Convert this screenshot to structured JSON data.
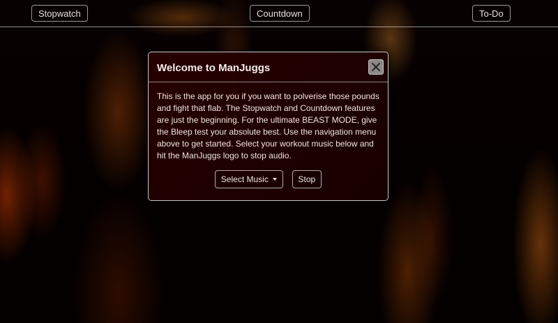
{
  "nav": {
    "stopwatch_label": "Stopwatch",
    "countdown_label": "Countdown",
    "todo_label": "To-Do"
  },
  "modal": {
    "title": "Welcome to ManJuggs",
    "body_text": "This is the app for you if you want to polverise those pounds and fight that flab. The Stopwatch and Countdown features are just the beginning. For the ultimate BEAST MODE, give the Bleep test your absolute best. Use the navigation menu above to get started. Select your workout music below and hit the ManJuggs logo to stop audio.",
    "select_music_label": "Select Music",
    "stop_label": "Stop"
  },
  "icons": {
    "close": "close-icon",
    "dropdown": "chevron-down-icon"
  },
  "colors": {
    "modal_bg": "#2a0000",
    "border": "#e6e6e6",
    "close_bg": "#8e8987"
  }
}
